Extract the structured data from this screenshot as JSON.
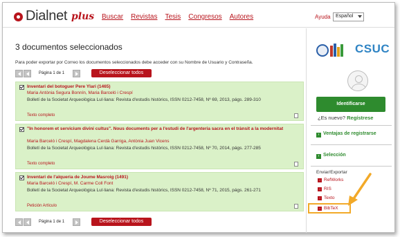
{
  "header": {
    "logo_text": "Dialnet",
    "logo_plus": "plus",
    "nav": [
      "Buscar",
      "Revistas",
      "Tesis",
      "Congresos",
      "Autores"
    ],
    "help": "Ayuda",
    "language": "Español"
  },
  "main": {
    "title": "3 documentos seleccionados",
    "note": "Para poder exportar por Correo los documentos seleccionados debe acceder con su Nombre de Usuario y Contraseña.",
    "pager_text": "Página 1 de 1",
    "deselect_label": "Deseleccionar todos",
    "records": [
      {
        "title": "Inventari del botoguer Pere Ylari (1465)",
        "authors": "Maria Antònia Segura Bonnín, Maria Barceló i Crespí",
        "source": "Bolletí de la Societat Arqueològica Lul·liana: Revista d'estudis històrics, ISSN 0212-7458, Nº 69, 2013, págs. 289-310",
        "link": "Texto completo"
      },
      {
        "title": "\"In honorem et servicium divini cultus\". Nous documents per a l'estudi de l'argenteria sacra en el trànsit a la modernitat",
        "authors": "Maria Barceló i Crespí, Magdalena Cerdà Garriga, Antònia Juan Vicens",
        "source": "Bolletí de la Societat Arqueològica Lul·liana: Revista d'estudis històrics, ISSN 0212-7458, Nº 70, 2014, págs. 277-285",
        "link": "Texto completo"
      },
      {
        "title": "Inventari de l'alqueria de Joume Masroig (1491)",
        "authors": "Maria Barceló i Crespí, M. Carme Coll Font",
        "source": "Bolletí de la Societat Arqueològica Lul·liana: Revista d'estudis històrics, ISSN 0212-7458, Nº 71, 2015, págs. 261-271",
        "link": "Petición Artículo"
      }
    ]
  },
  "sidebar": {
    "csuc": "CSUC",
    "identify_label": "Identificarse",
    "new_user_question": "¿Es nuevo?",
    "register_label": "Regístrese",
    "benefits_label": "Ventajas de registrarse",
    "selection_label": "Selección",
    "export_label": "Enviar/Exportar",
    "export_items": [
      "RefWorks",
      "RIS",
      "Texto",
      "BibTeX"
    ]
  },
  "colors": {
    "brand_red": "#b8141c",
    "green": "#2e8b2e",
    "record_bg": "#daf1c8",
    "highlight": "#f2a928"
  }
}
